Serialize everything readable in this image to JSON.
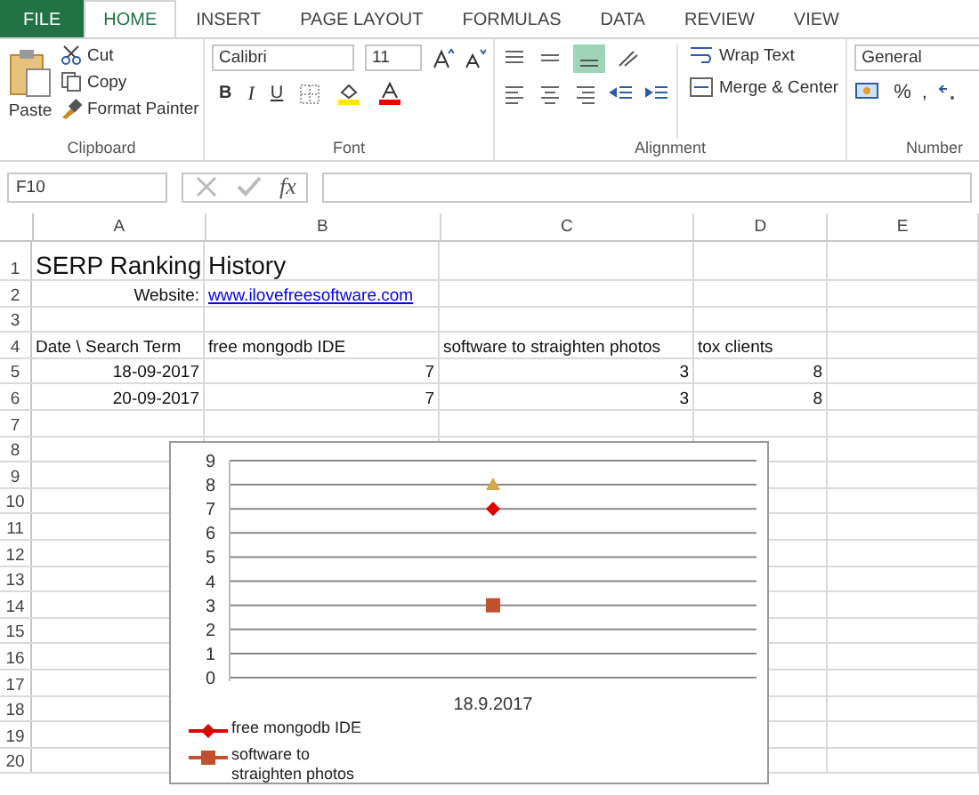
{
  "ribbon_tabs": [
    {
      "label": "FILE",
      "kind": "file",
      "selected": false
    },
    {
      "label": "HOME",
      "kind": "tab",
      "selected": true
    },
    {
      "label": "INSERT",
      "kind": "tab",
      "selected": false
    },
    {
      "label": "PAGE LAYOUT",
      "kind": "tab",
      "selected": false
    },
    {
      "label": "FORMULAS",
      "kind": "tab",
      "selected": false
    },
    {
      "label": "DATA",
      "kind": "tab",
      "selected": false
    },
    {
      "label": "REVIEW",
      "kind": "tab",
      "selected": false
    },
    {
      "label": "VIEW",
      "kind": "tab",
      "selected": false
    }
  ],
  "clipboard": {
    "paste": "Paste",
    "cut": "Cut",
    "copy": "Copy",
    "format_painter": "Format Painter",
    "group_label": "Clipboard"
  },
  "font": {
    "name": "Calibri",
    "size": "11",
    "bold": "B",
    "italic": "I",
    "underline": "U",
    "group_label": "Font"
  },
  "alignment": {
    "wrap_text": "Wrap Text",
    "merge_center": "Merge & Center",
    "group_label": "Alignment"
  },
  "number": {
    "format": "General",
    "percent": "%",
    "comma": ",",
    "group_label": "Number"
  },
  "formula_bar": {
    "name_box": "F10",
    "fx": "fx"
  },
  "columns": [
    "A",
    "B",
    "C",
    "D",
    "E"
  ],
  "rows": [
    {
      "number": "1",
      "cells": [
        {
          "text": "SERP Ranking History",
          "kind": "title"
        }
      ]
    },
    {
      "number": "2",
      "cells": [
        {
          "text": "Website:",
          "kind": "label"
        },
        {
          "text": "www.ilovefreesoftware.com",
          "kind": "link"
        }
      ]
    },
    {
      "number": "3",
      "cells": []
    },
    {
      "number": "4",
      "cells": [
        {
          "text": "Date \\ Search Term",
          "kind": "text"
        },
        {
          "text": "free mongodb IDE",
          "kind": "text"
        },
        {
          "text": "software to straighten photos",
          "kind": "text"
        },
        {
          "text": "tox clients",
          "kind": "text"
        }
      ]
    },
    {
      "number": "5",
      "cells": [
        {
          "text": "18-09-2017",
          "kind": "num"
        },
        {
          "text": "7",
          "kind": "num"
        },
        {
          "text": "3",
          "kind": "num"
        },
        {
          "text": "8",
          "kind": "num"
        }
      ]
    },
    {
      "number": "6",
      "cells": [
        {
          "text": "20-09-2017",
          "kind": "num"
        },
        {
          "text": "7",
          "kind": "num"
        },
        {
          "text": "3",
          "kind": "num"
        },
        {
          "text": "8",
          "kind": "num"
        }
      ]
    },
    {
      "number": "7",
      "cells": []
    },
    {
      "number": "8",
      "cells": []
    },
    {
      "number": "9",
      "cells": []
    },
    {
      "number": "10",
      "cells": []
    },
    {
      "number": "11",
      "cells": []
    },
    {
      "number": "12",
      "cells": []
    },
    {
      "number": "13",
      "cells": []
    },
    {
      "number": "14",
      "cells": []
    },
    {
      "number": "15",
      "cells": []
    },
    {
      "number": "16",
      "cells": []
    },
    {
      "number": "17",
      "cells": []
    },
    {
      "number": "18",
      "cells": []
    },
    {
      "number": "19",
      "cells": []
    },
    {
      "number": "20",
      "cells": []
    }
  ],
  "chart": {
    "chart_data": {
      "type": "line",
      "grid": true,
      "categories": [
        "18.9.2017"
      ],
      "ylim": [
        0,
        9
      ],
      "yticks": [
        0,
        1,
        2,
        3,
        4,
        5,
        6,
        7,
        8,
        9
      ],
      "series": [
        {
          "name": "free mongodb IDE",
          "color": "#e00000",
          "marker": "diamond",
          "values": [
            7
          ]
        },
        {
          "name": "software to straighten photos",
          "color": "#c0502e",
          "marker": "square",
          "values": [
            3
          ]
        },
        {
          "color": "#d4a64a",
          "marker": "triangle",
          "values": [
            8
          ]
        }
      ]
    }
  }
}
